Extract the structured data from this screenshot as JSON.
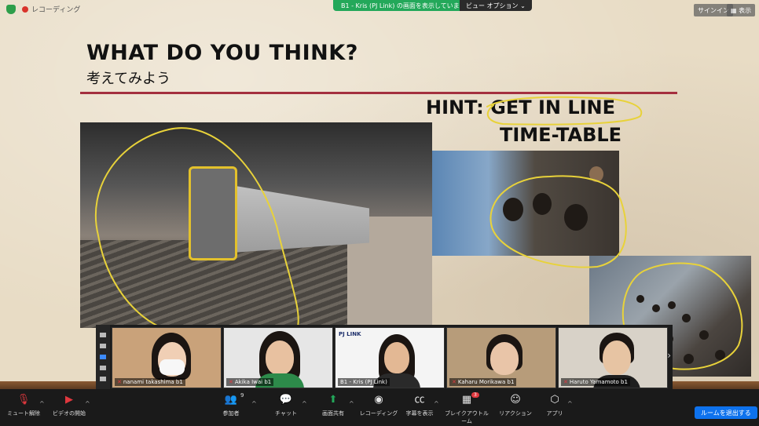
{
  "colors": {
    "accent_red": "#a4303f",
    "share_green": "#23a85a",
    "leave_blue": "#0e72ed",
    "highlight_yellow": "#e8d23a"
  },
  "topbar": {
    "recording_label": "レコーディング",
    "share_status": "B1 - Kris (PJ Link) の画面を表示しています",
    "view_options": "ビュー オプション",
    "sign_in": "サインイン",
    "display": "表示"
  },
  "slide": {
    "title_en": "WHAT DO YOU THINK?",
    "title_jp": "考えてみよう",
    "hint_line1_prefix": "HINT:",
    "hint_line1_highlight": "GET IN LINE",
    "hint_line2": "TIME-TABLE"
  },
  "gallery": {
    "participants": [
      {
        "name": "nanami takashima b1",
        "muted": true
      },
      {
        "name": "Akika Iwai b1",
        "muted": true
      },
      {
        "name": "B1 - Kris (PJ Link)",
        "muted": false
      },
      {
        "name": "Kaharu Morikawa b1",
        "muted": true
      },
      {
        "name": "Haruto Yamamoto b1",
        "muted": true
      }
    ],
    "host_logo_text": "PJ LINK"
  },
  "toolbar": {
    "mute_label": "ミュート解除",
    "video_label": "ビデオの開始",
    "participants_label": "参加者",
    "participants_count": "9",
    "chat_label": "チャット",
    "share_label": "画面共有",
    "record_label": "レコーディング",
    "captions_label": "字幕を表示",
    "breakout_label": "ブレイクアウトルーム",
    "breakout_badge": "3",
    "reactions_label": "リアクション",
    "apps_label": "アプリ",
    "leave_label": "ルームを退出する"
  }
}
